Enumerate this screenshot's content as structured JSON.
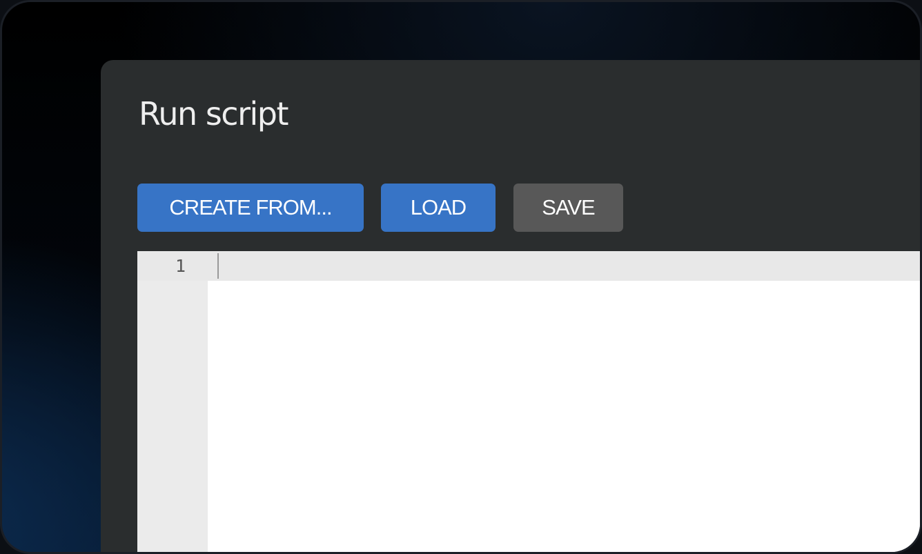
{
  "dialog": {
    "title": "Run script"
  },
  "toolbar": {
    "create_from_label": "CREATE FROM...",
    "load_label": "LOAD",
    "save_label": "SAVE"
  },
  "editor": {
    "line_numbers": [
      "1"
    ],
    "content": ""
  },
  "colors": {
    "panel_background": "#2a2d2e",
    "primary_button": "#3774c6",
    "secondary_button": "#585858",
    "editor_background": "#ffffff",
    "gutter_background": "#ebebeb"
  }
}
